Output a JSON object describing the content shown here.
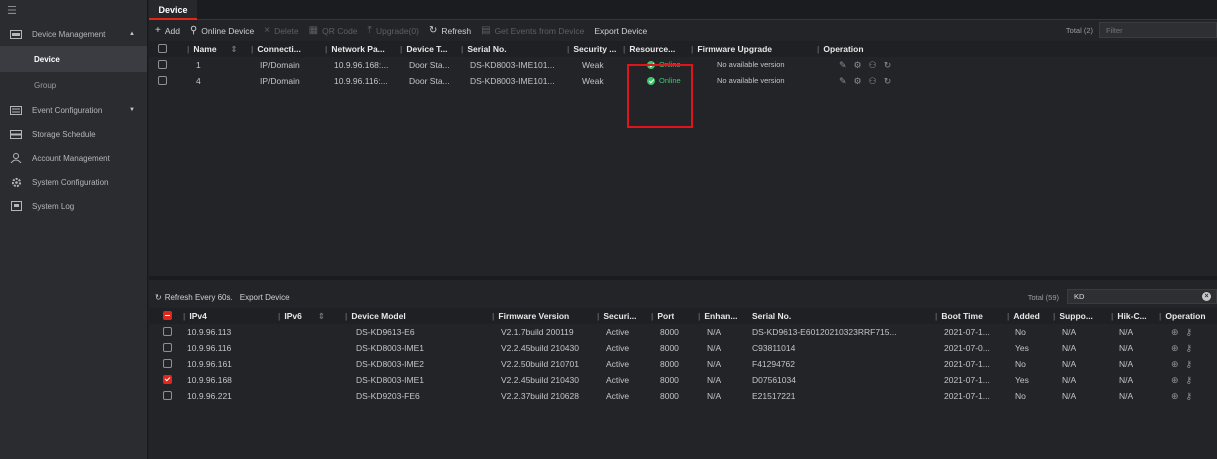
{
  "sidebar": {
    "menu_icon": "hamburger-icon",
    "items": [
      {
        "label": "Device Management",
        "icon": "device-management-icon",
        "expanded": true
      },
      {
        "label": "Device",
        "sub": true,
        "active": true
      },
      {
        "label": "Group",
        "sub": true
      },
      {
        "label": "Event Configuration",
        "icon": "event-icon",
        "expanded": false
      },
      {
        "label": "Storage Schedule",
        "icon": "storage-icon"
      },
      {
        "label": "Account Management",
        "icon": "user-icon"
      },
      {
        "label": "System Configuration",
        "icon": "gear-icon"
      },
      {
        "label": "System Log",
        "icon": "log-icon"
      }
    ]
  },
  "tab": {
    "label": "Device"
  },
  "toolbar": {
    "add": "Add",
    "online_device": "Online Device",
    "delete": "Delete",
    "qr_code": "QR Code",
    "upgrade": "Upgrade(0)",
    "refresh": "Refresh",
    "get_events": "Get Events from Device",
    "export": "Export Device",
    "total": "Total (2)",
    "filter_placeholder": "Filter"
  },
  "device_table": {
    "headers": [
      "Name",
      "Connecti...",
      "Network Pa...",
      "Device T...",
      "Serial No.",
      "Security ...",
      "Resource...",
      "Firmware Upgrade",
      "Operation"
    ],
    "rows": [
      {
        "name": "1",
        "connection": "IP/Domain",
        "network": "10.9.96.168:...",
        "type": "Door Sta...",
        "serial": "DS-KD8003-IME101...",
        "security": "Weak",
        "resource": "Online",
        "firmware": "No available version"
      },
      {
        "name": "4",
        "connection": "IP/Domain",
        "network": "10.9.96.116:...",
        "type": "Door Sta...",
        "serial": "DS-KD8003-IME101...",
        "security": "Weak",
        "resource": "Online",
        "firmware": "No available version"
      }
    ]
  },
  "online_section": {
    "refresh_label": "Refresh Every 60s.",
    "export_label": "Export Device",
    "total": "Total (59)",
    "search_value": "KD",
    "headers": [
      "IPv4",
      "IPv6",
      "Device Model",
      "Firmware Version",
      "Securi...",
      "Port",
      "Enhan...",
      "Serial No.",
      "Boot Time",
      "Added",
      "Suppo...",
      "Hik-C...",
      "Operation"
    ],
    "rows": [
      {
        "checked": false,
        "ipv4": "10.9.96.113",
        "ipv6": "",
        "model": "DS-KD9613-E6",
        "firmware": "V2.1.7build 200119",
        "security": "Active",
        "port": "8000",
        "enhanced": "N/A",
        "serial": "DS-KD9613-E60120210323RRF715...",
        "boot": "2021-07-1...",
        "added": "No",
        "support": "N/A",
        "hik": "N/A"
      },
      {
        "checked": false,
        "ipv4": "10.9.96.116",
        "ipv6": "",
        "model": "DS-KD8003-IME1",
        "firmware": "V2.2.45build 210430",
        "security": "Active",
        "port": "8000",
        "enhanced": "N/A",
        "serial": "C93811014",
        "boot": "2021-07-0...",
        "added": "Yes",
        "support": "N/A",
        "hik": "N/A"
      },
      {
        "checked": false,
        "ipv4": "10.9.96.161",
        "ipv6": "",
        "model": "DS-KD8003-IME2",
        "firmware": "V2.2.50build 210701",
        "security": "Active",
        "port": "8000",
        "enhanced": "N/A",
        "serial": "F41294762",
        "boot": "2021-07-1...",
        "added": "No",
        "support": "N/A",
        "hik": "N/A"
      },
      {
        "checked": true,
        "ipv4": "10.9.96.168",
        "ipv6": "",
        "model": "DS-KD8003-IME1",
        "firmware": "V2.2.45build 210430",
        "security": "Active",
        "port": "8000",
        "enhanced": "N/A",
        "serial": "D07561034",
        "boot": "2021-07-1...",
        "added": "Yes",
        "support": "N/A",
        "hik": "N/A"
      },
      {
        "checked": false,
        "ipv4": "10.9.96.221",
        "ipv6": "",
        "model": "DS-KD9203-FE6",
        "firmware": "V2.2.37build 210628",
        "security": "Active",
        "port": "8000",
        "enhanced": "N/A",
        "serial": "E21517221",
        "boot": "2021-07-1...",
        "added": "No",
        "support": "N/A",
        "hik": "N/A"
      }
    ]
  },
  "colors": {
    "accent": "#e1261c",
    "online": "#3cc46a",
    "highlight": "#e0141c"
  }
}
